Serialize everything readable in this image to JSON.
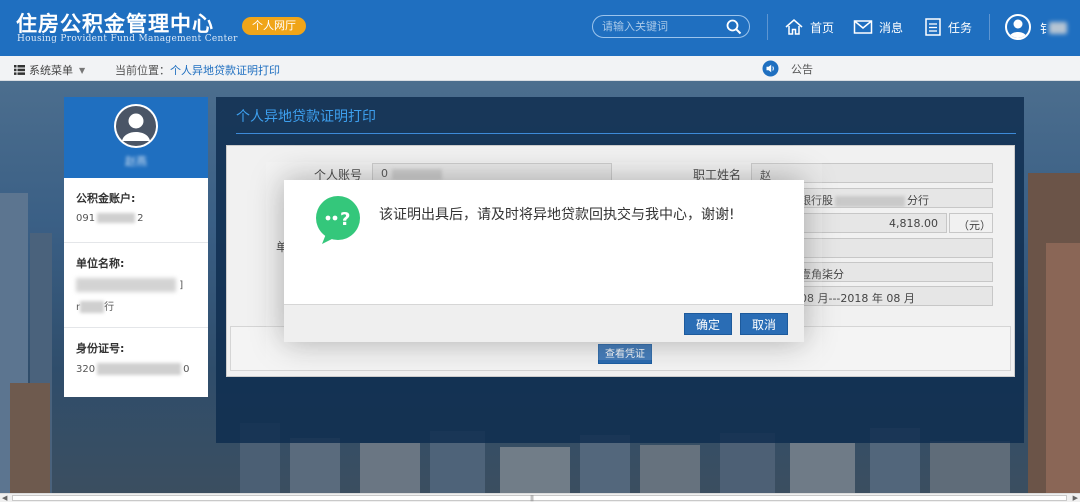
{
  "header": {
    "logo_cn": "住房公积金管理中心",
    "logo_en": "Housing Provident Fund Management Center",
    "hall_label": "个人网厅",
    "search_placeholder": "请输入关键词",
    "nav": [
      {
        "label": "首页",
        "icon": "home-icon"
      },
      {
        "label": "消息",
        "icon": "mail-icon"
      },
      {
        "label": "任务",
        "icon": "task-icon"
      }
    ],
    "user_name": "钅"
  },
  "subbar": {
    "menu_label": "系统菜单",
    "breadcrumb_prefix": "当前位置：",
    "breadcrumb_current": "个人异地贷款证明打印",
    "notice_label": "公告"
  },
  "profile": {
    "name": "赵燕",
    "account_label": "公积金账户:",
    "account_value": "091",
    "account_suffix": "2",
    "unit_label": "单位名称:",
    "unit_value_tail": "]",
    "unit_value_line2": "行",
    "unit_value_line2_prefix": "r",
    "id_label": "身份证号:",
    "id_value": "320",
    "id_suffix": "0"
  },
  "main": {
    "title": "个人异地贷款证明打印",
    "fields": {
      "account_label": "个人账号",
      "account_value": "0",
      "name_label": "职工姓名",
      "name_value": "赵",
      "bank_value": "银行股",
      "bank_suffix": "分行",
      "amount_value": "4,818.00",
      "amount_unit": "（元）",
      "amount_words": "壹角柒分",
      "period_value": "08 月---2018 年 08 月",
      "left_partial_label": "单"
    },
    "view_button": "查看凭证"
  },
  "modal": {
    "message": "该证明出具后，请及时将异地贷款回执交与我中心，谢谢!",
    "confirm": "确定",
    "cancel": "取消"
  },
  "colors": {
    "header_bg": "#1f6fc0",
    "accent_orange": "#f0a519",
    "modal_icon": "#34c77b",
    "button_blue": "#2a6db5"
  }
}
